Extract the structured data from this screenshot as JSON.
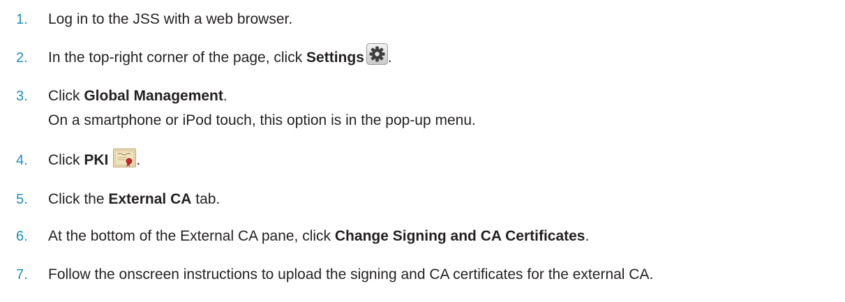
{
  "steps": [
    {
      "number": "1.",
      "text": "Log in to the JSS with a web browser."
    },
    {
      "number": "2.",
      "prefix": "In the top-right corner of the page, click ",
      "bold": "Settings",
      "suffix": ".",
      "icon": "gear-icon"
    },
    {
      "number": "3.",
      "prefix": "Click ",
      "bold": "Global Management",
      "suffix": ".",
      "note": "On a smartphone or iPod touch, this option is in the pop-up menu."
    },
    {
      "number": "4.",
      "prefix": "Click ",
      "bold": "PKI",
      "suffix": ".",
      "icon": "certificate-icon"
    },
    {
      "number": "5.",
      "prefix": "Click the ",
      "bold": "External CA",
      "suffix": " tab."
    },
    {
      "number": "6.",
      "prefix": "At the bottom of the External CA pane, click ",
      "bold": "Change Signing and CA Certificates",
      "suffix": "."
    },
    {
      "number": "7.",
      "text": "Follow the onscreen instructions to upload the signing and CA certificates for the external CA."
    }
  ],
  "colors": {
    "step_number": "#1a8fb8",
    "text": "#231f20"
  }
}
